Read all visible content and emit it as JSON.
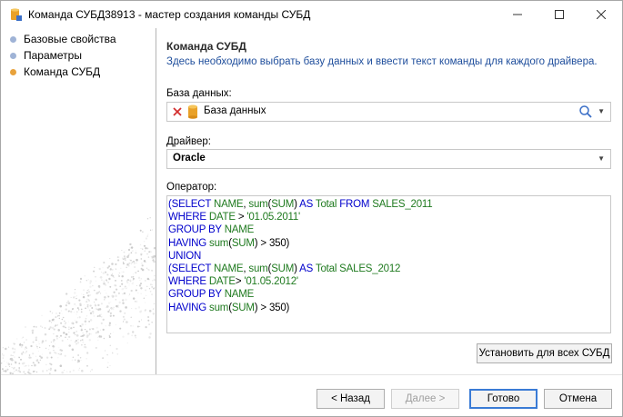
{
  "window": {
    "title": "Команда СУБД38913 - мастер создания команды СУБД",
    "minimize_icon": "minimize-icon",
    "maximize_icon": "maximize-icon",
    "close_icon": "close-icon"
  },
  "steps": [
    {
      "label": "Базовые свойства",
      "state": "done",
      "color": "#9fb3d6"
    },
    {
      "label": "Параметры",
      "state": "done",
      "color": "#9fb3d6"
    },
    {
      "label": "Команда СУБД",
      "state": "current",
      "color": "#e8a23c"
    }
  ],
  "page": {
    "heading": "Команда СУБД",
    "description": "Здесь необходимо выбрать базу данных и ввести текст команды для каждого драйвера."
  },
  "database": {
    "label": "База данных:",
    "value": "База данных"
  },
  "driver": {
    "label": "Драйвер:",
    "value": "Oracle"
  },
  "operator": {
    "label": "Оператор:",
    "lines": [
      [
        [
          "kw",
          "(SELECT "
        ],
        [
          "tx",
          "NAME"
        ],
        [
          "op",
          ", "
        ],
        [
          "fn",
          "sum"
        ],
        [
          "op",
          "("
        ],
        [
          "tx",
          "SUM"
        ],
        [
          "op",
          ") "
        ],
        [
          "kw",
          "AS "
        ],
        [
          "tx",
          "Total "
        ],
        [
          "kw",
          "FROM "
        ],
        [
          "tx",
          "SALES_2011"
        ]
      ],
      [
        [
          "kw",
          "WHERE "
        ],
        [
          "tx",
          "DATE"
        ],
        [
          "op",
          " > "
        ],
        [
          "str",
          "'01.05.2011'"
        ]
      ],
      [
        [
          "kw",
          "GROUP BY "
        ],
        [
          "tx",
          "NAME"
        ]
      ],
      [
        [
          "kw",
          "HAVING "
        ],
        [
          "fn",
          "sum"
        ],
        [
          "op",
          "("
        ],
        [
          "tx",
          "SUM"
        ],
        [
          "op",
          ") > "
        ],
        [
          "num",
          "350"
        ],
        [
          "op",
          ")"
        ]
      ],
      [
        [
          "kw",
          "UNION"
        ]
      ],
      [
        [
          "kw",
          "(SELECT "
        ],
        [
          "tx",
          "NAME"
        ],
        [
          "op",
          ", "
        ],
        [
          "fn",
          "sum"
        ],
        [
          "op",
          "("
        ],
        [
          "tx",
          "SUM"
        ],
        [
          "op",
          ") "
        ],
        [
          "kw",
          "AS "
        ],
        [
          "tx",
          "Total SALES_2012"
        ]
      ],
      [
        [
          "kw",
          "WHERE "
        ],
        [
          "tx",
          "DATE"
        ],
        [
          "op",
          "> "
        ],
        [
          "str",
          "'01.05.2012'"
        ]
      ],
      [
        [
          "kw",
          "GROUP BY "
        ],
        [
          "tx",
          "NAME"
        ]
      ],
      [
        [
          "kw",
          "HAVING "
        ],
        [
          "fn",
          "sum"
        ],
        [
          "op",
          "("
        ],
        [
          "tx",
          "SUM"
        ],
        [
          "op",
          ") > "
        ],
        [
          "num",
          "350"
        ],
        [
          "op",
          ")"
        ]
      ]
    ]
  },
  "buttons": {
    "set_all": "Установить для всех СУБД",
    "back": "< Назад",
    "next": "Далее >",
    "done": "Готово",
    "cancel": "Отмена"
  }
}
